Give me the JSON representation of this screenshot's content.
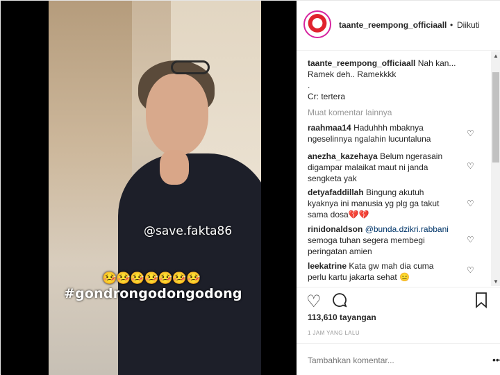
{
  "header": {
    "username": "taante_reempong_officiaall",
    "separator": "•",
    "follow_status": "Diikuti"
  },
  "media": {
    "watermark": "@save.fakta86",
    "emoji_row": "🤒🤒🤒🤒🤒🤒🤒",
    "hashtag": "#gondrongodongodong"
  },
  "caption": {
    "username": "taante_reempong_officiaall",
    "line1": "Nah kan...",
    "line2": "Ramek deh.. Ramekkkk",
    "line3": ".",
    "line4": "Cr: tertera"
  },
  "more_comments": "Muat komentar lainnya",
  "comments": [
    {
      "username": "raahmaa14",
      "text1": "Haduhhh mbaknya",
      "text2": "ngeselinnya ngalahin lucuntaluna"
    },
    {
      "username": "anezha_kazehaya",
      "text1": "Belum ngerasain",
      "text2": "digampar malaikat maut ni janda",
      "text3": "sengketa yak"
    },
    {
      "username": "detyafaddillah",
      "text1": "Bingung akutuh",
      "text2": "kyaknya ini manusia yg plg ga takut",
      "text3": "sama dosa💔💔"
    },
    {
      "username": "rinidonaldson",
      "mention": "@bunda.dzikri.rabbani",
      "text2": "semoga tuhan segera membegi",
      "text3": "peringatan amien"
    },
    {
      "username": "leekatrine",
      "text1": "Kata gw mah dia cuma",
      "text2": "perlu kartu jakarta sehat 😑"
    }
  ],
  "actions": {
    "like_icon": "heart-icon",
    "comment_icon": "comment-icon",
    "save_icon": "bookmark-icon"
  },
  "views": "113,610 tayangan",
  "time_ago": "1 JAM YANG LALU",
  "add_comment_placeholder": "Tambahkan komentar...",
  "more_options": "•••"
}
